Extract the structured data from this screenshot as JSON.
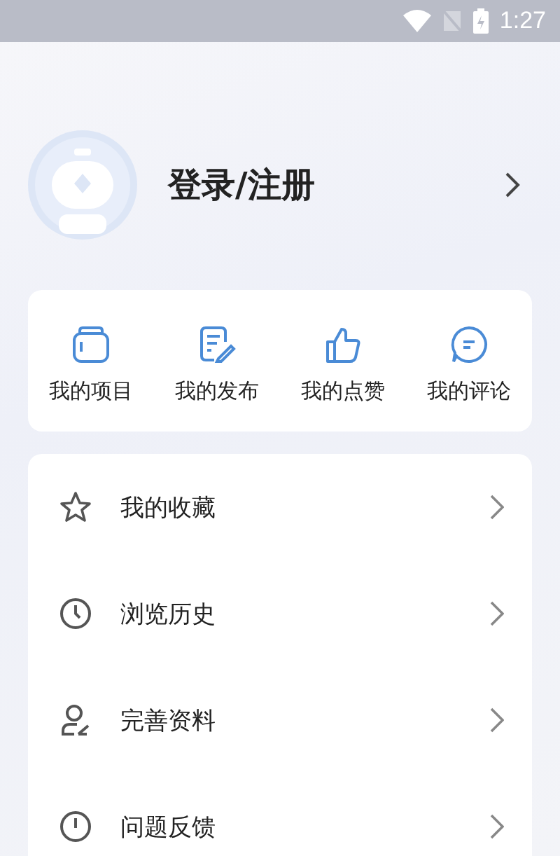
{
  "status_bar": {
    "time": "1:27"
  },
  "profile": {
    "title": "登录/注册"
  },
  "shortcuts": [
    {
      "kind": "folder",
      "label": "我的项目"
    },
    {
      "kind": "edit",
      "label": "我的发布"
    },
    {
      "kind": "like",
      "label": "我的点赞"
    },
    {
      "kind": "comment",
      "label": "我的评论"
    }
  ],
  "menu": [
    {
      "kind": "star",
      "label": "我的收藏"
    },
    {
      "kind": "clock",
      "label": "浏览历史"
    },
    {
      "kind": "profile",
      "label": "完善资料"
    },
    {
      "kind": "info",
      "label": "问题反馈"
    }
  ]
}
